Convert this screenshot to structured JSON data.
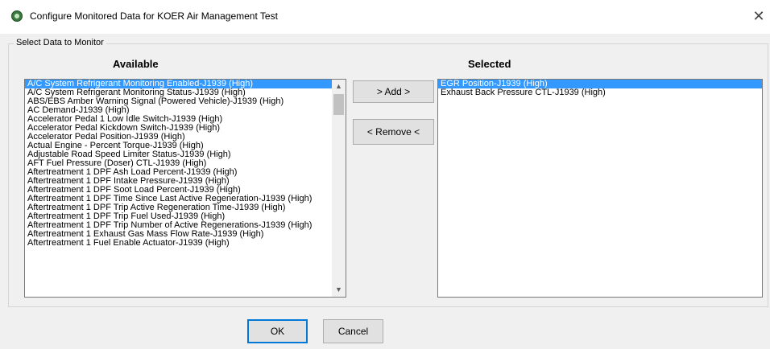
{
  "window": {
    "title": "Configure Monitored Data for KOER Air Management Test",
    "close_glyph": "✕",
    "icon": "app-icon"
  },
  "group": {
    "label": "Select Data to Monitor"
  },
  "available": {
    "header": "Available",
    "items": [
      "A/C System Refrigerant Monitoring Enabled-J1939 (High)",
      "A/C System Refrigerant Monitoring Status-J1939 (High)",
      "ABS/EBS Amber Warning Signal (Powered Vehicle)-J1939 (High)",
      "AC Demand-J1939 (High)",
      "Accelerator Pedal 1 Low Idle Switch-J1939 (High)",
      "Accelerator Pedal Kickdown Switch-J1939 (High)",
      "Accelerator Pedal Position-J1939 (High)",
      "Actual Engine - Percent Torque-J1939 (High)",
      "Adjustable Road Speed Limiter Status-J1939 (High)",
      "AFT Fuel Pressure (Doser) CTL-J1939 (High)",
      "Aftertreatment 1 DPF Ash Load Percent-J1939 (High)",
      "Aftertreatment 1 DPF Intake Pressure-J1939 (High)",
      "Aftertreatment 1 DPF Soot Load Percent-J1939 (High)",
      "Aftertreatment 1 DPF Time Since Last Active Regeneration-J1939 (High)",
      "Aftertreatment 1 DPF Trip Active Regeneration Time-J1939 (High)",
      "Aftertreatment 1 DPF Trip Fuel Used-J1939 (High)",
      "Aftertreatment 1 DPF Trip Number of Active Regenerations-J1939 (High)",
      "Aftertreatment 1 Exhaust Gas Mass Flow Rate-J1939 (High)",
      "Aftertreatment 1 Fuel Enable Actuator-J1939 (High)"
    ],
    "selected_index": 0
  },
  "selected": {
    "header": "Selected",
    "items": [
      "EGR Position-J1939 (High)",
      "Exhaust Back Pressure CTL-J1939 (High)"
    ],
    "selected_index": 0
  },
  "buttons": {
    "add": "> Add >",
    "remove": "< Remove <",
    "ok": "OK",
    "cancel": "Cancel"
  },
  "colors": {
    "selection": "#3399ff",
    "default_button_border": "#0078d7"
  }
}
